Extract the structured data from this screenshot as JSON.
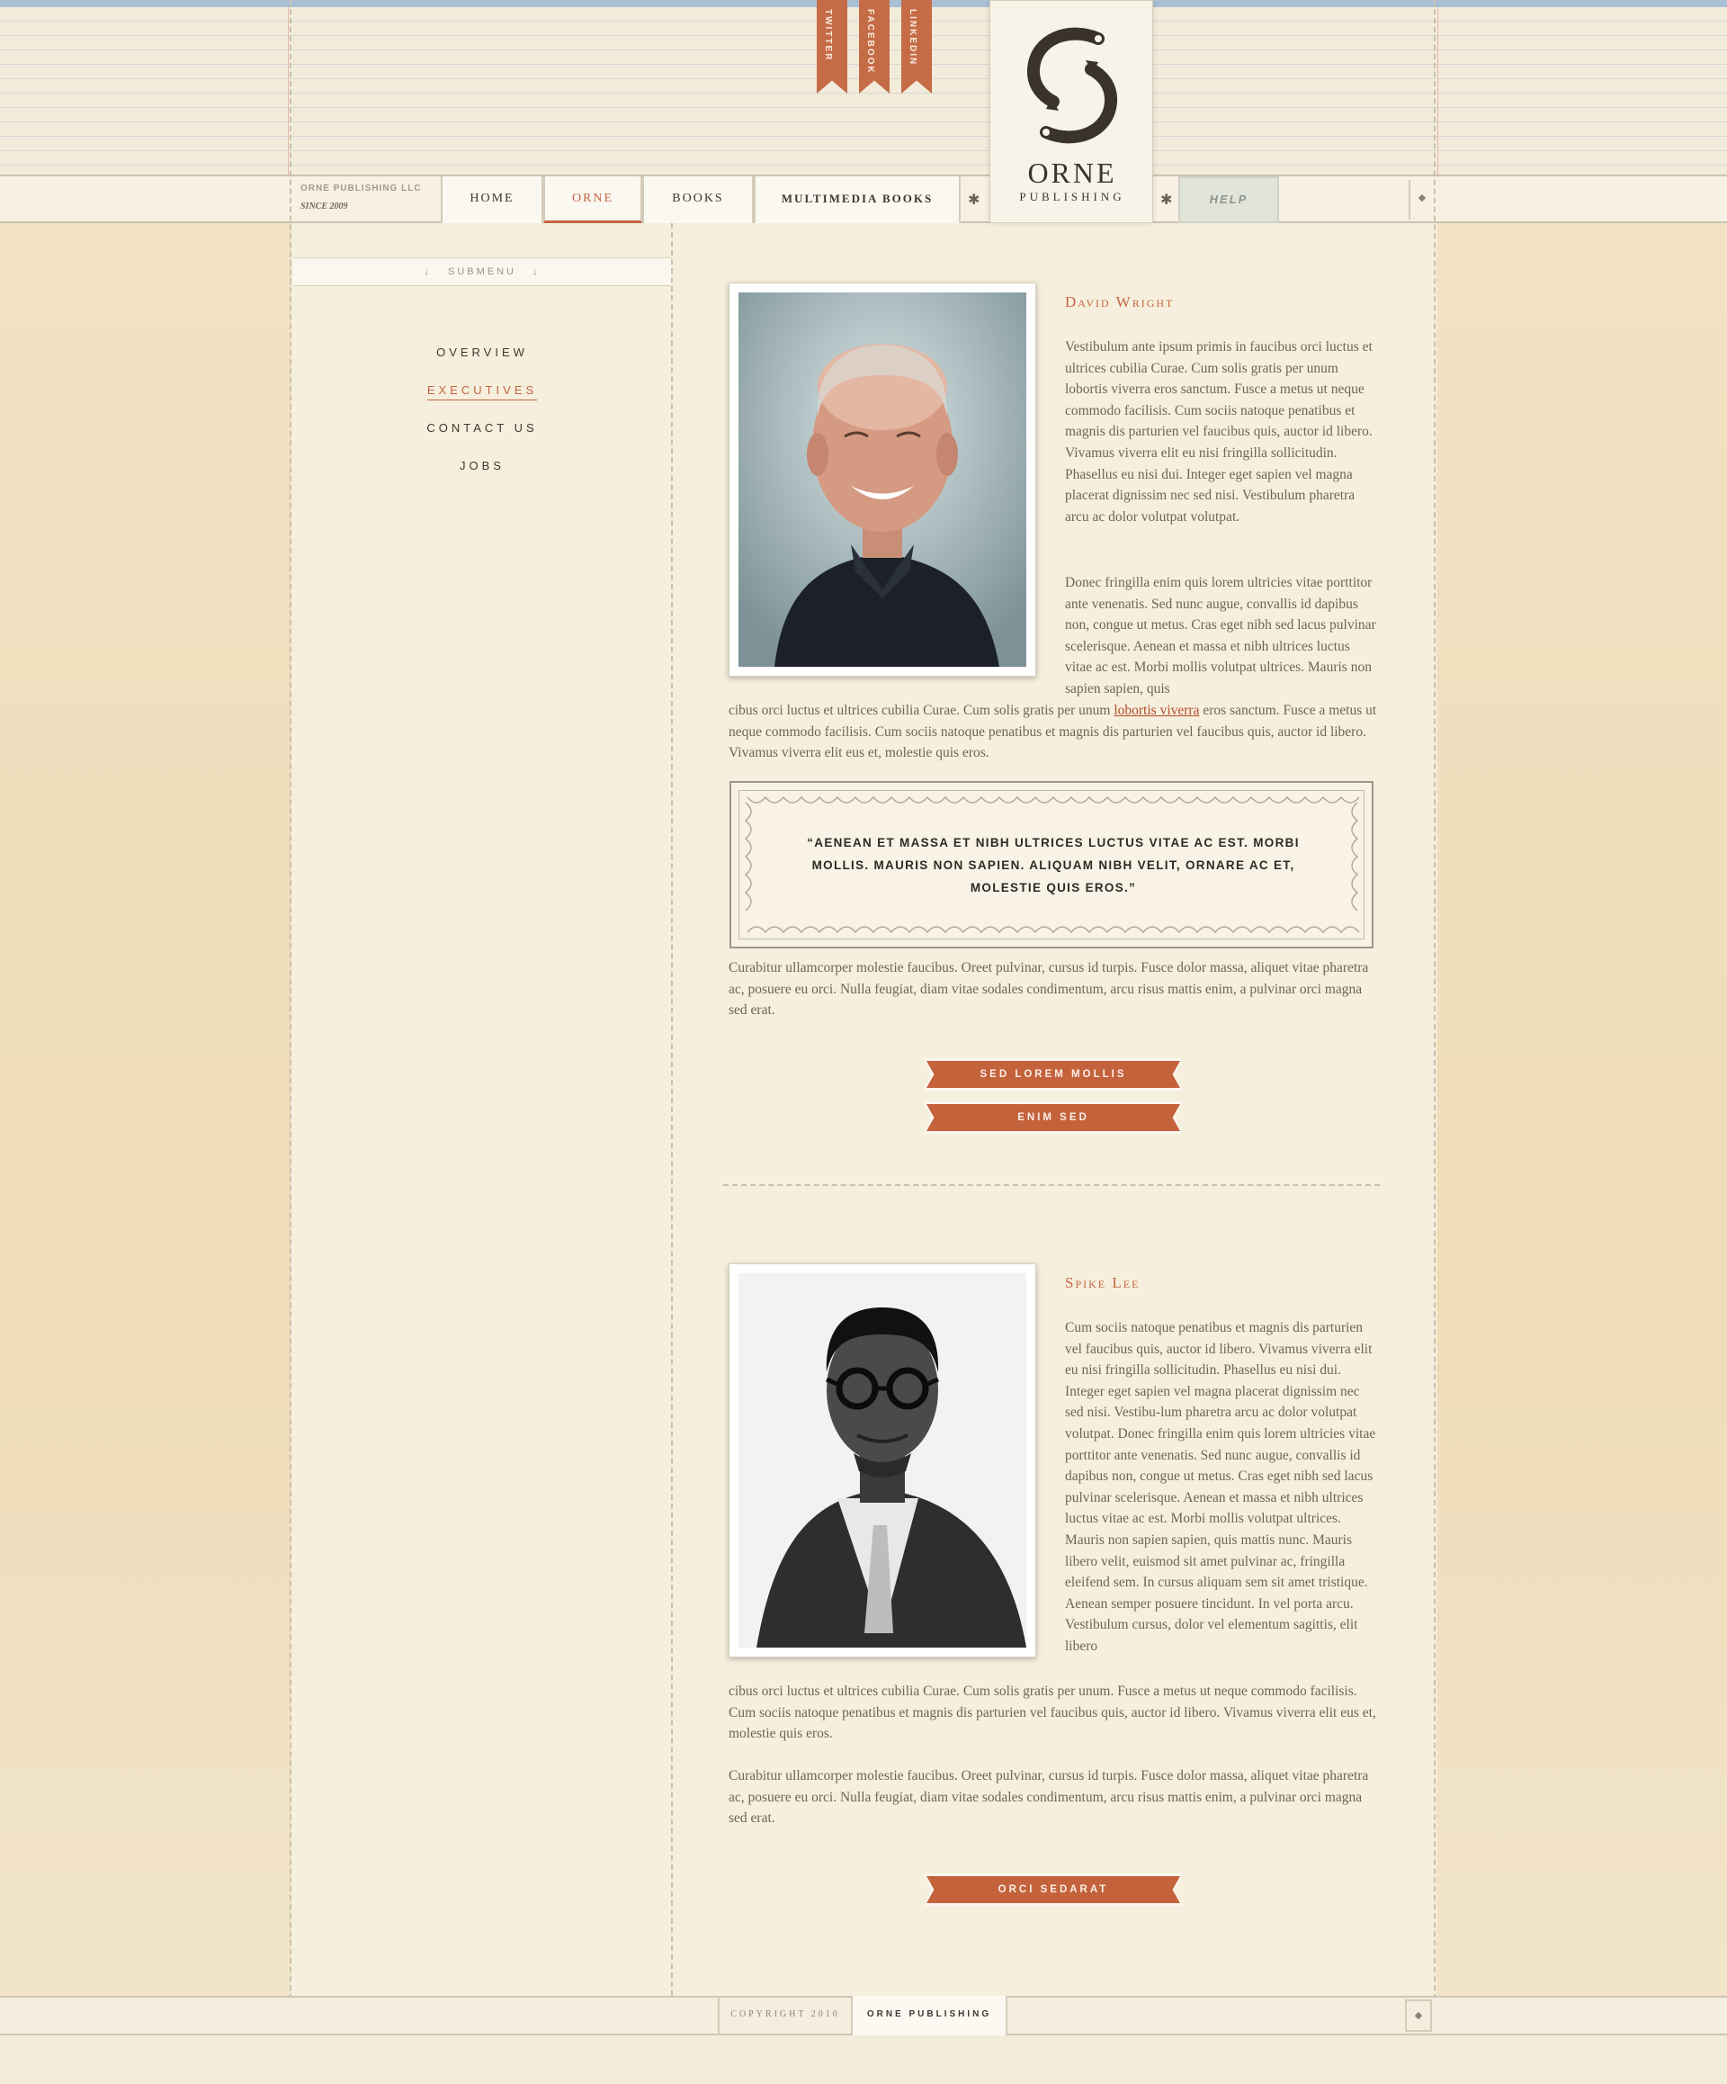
{
  "social": [
    {
      "label": "TWITTER",
      "icon": "ribbon-bookmark-icon"
    },
    {
      "label": "FACEBOOK",
      "icon": "ribbon-bookmark-icon"
    },
    {
      "label": "LINKEDIN",
      "icon": "ribbon-bookmark-icon"
    }
  ],
  "logo": {
    "name": "ORNE",
    "sub": "PUBLISHING",
    "icon": "fish-emblem-icon"
  },
  "company": {
    "name": "ORNE PUBLISHING LLC",
    "since": "SINCE 2009"
  },
  "nav": {
    "items": [
      {
        "label": "HOME"
      },
      {
        "label": "ORNE"
      },
      {
        "label": "BOOKS"
      },
      {
        "label": "MULTIMEDIA BOOKS"
      }
    ],
    "active": "ORNE",
    "help": "HELP",
    "separator": "✱"
  },
  "submenu": {
    "title": "SUBMENU",
    "icon": "arrow-down-icon",
    "items": [
      {
        "label": "OVERVIEW"
      },
      {
        "label": "EXECUTIVES"
      },
      {
        "label": "CONTACT US"
      },
      {
        "label": "JOBS"
      }
    ],
    "active": "EXECUTIVES"
  },
  "executives": [
    {
      "name": "David Wright",
      "p1": "Vestibulum ante ipsum primis in faucibus orci luctus et ultrices cubilia Curae. Cum solis gratis per unum lobortis viverra eros sanctum. Fusce a metus ut neque commodo facilisis. Cum sociis natoque penatibus et magnis dis parturien vel faucibus quis, auctor id libero. Vivamus viverra elit eu nisi fringilla sollicitudin. Phasellus eu nisi dui. Integer eget sapien vel magna placerat dignissim nec sed nisi. Vestibulum pharetra arcu ac dolor volutpat volutpat.",
      "p2_wrap": "Donec fringilla enim quis lorem ultricies vitae porttitor ante venenatis. Sed nunc augue, convallis id dapibus non, congue ut metus. Cras eget nibh sed lacus pulvinar scelerisque. Aenean et massa et nibh ultrices luctus vitae ac est. Morbi mollis volutpat ultrices. Mauris non sapien sapien, quis",
      "p2_full_a": "cibus orci luctus et ultrices cubilia Curae. Cum solis gratis per unum ",
      "p2_link": "lobortis viverra",
      "p2_full_b": " eros sanctum. Fusce a metus ut neque commodo facilisis. Cum sociis natoque penatibus et magnis dis parturien vel faucibus quis, auctor id libero. Vivamus viverra elit eus et, molestie quis eros.",
      "quote": "“Aenean et massa et nibh ultrices luctus vitae ac est. Morbi mollis. Mauris non sapien. Aliquam nibh velit, ornare ac et, molestie quis eros.”",
      "p3": "Curabitur ullamcorper molestie faucibus. Oreet pulvinar, cursus id turpis. Fusce dolor massa, aliquet vitae pharetra ac, posuere eu orci. Nulla feugiat, diam vitae sodales condimentum, arcu risus mattis enim, a pulvinar orci magna sed erat.",
      "buttons": [
        "SED LOREM MOLLIS",
        "ENIM SED"
      ]
    },
    {
      "name": "Spike Lee",
      "p1_wrap": "Cum sociis natoque penatibus et magnis dis parturien vel faucibus quis, auctor id libero. Vivamus viverra elit eu nisi fringilla sollicitudin. Phasellus eu nisi dui. Integer eget sapien vel magna placerat dignissim nec sed nisi. Vestibu-lum pharetra arcu ac dolor volutpat volutpat. Donec fringilla enim quis lorem ultricies vitae porttitor ante venenatis. Sed nunc augue, convallis id dapibus non, congue ut metus. Cras eget nibh sed lacus pulvinar scelerisque. Aenean et massa et nibh ultrices luctus vitae ac est. Morbi mollis volutpat ultrices. Mauris non sapien sapien, quis mattis nunc. Mauris libero velit, euismod sit amet pulvinar ac, fringilla eleifend sem. In cursus aliquam sem sit amet tristique. Aenean semper posuere tincidunt. In vel porta arcu. Vestibulum cursus, dolor vel elementum sagittis, elit libero",
      "p1_full": "cibus orci luctus et ultrices cubilia Curae. Cum solis gratis per unum. Fusce a metus ut neque commodo facilisis. Cum sociis natoque penatibus et magnis dis parturien vel faucibus quis, auctor id libero. Vivamus viverra elit eus et, molestie quis eros.",
      "p3": "Curabitur ullamcorper molestie faucibus. Oreet pulvinar, cursus id turpis. Fusce dolor massa, aliquet vitae pharetra ac, posuere eu orci. Nulla feugiat, diam vitae sodales condimentum, arcu risus mattis enim, a pulvinar orci magna sed erat.",
      "buttons": [
        "ORCI SEDARAT"
      ]
    }
  ],
  "footer": {
    "copyright": "COPYRIGHT 2010",
    "brand": "ORNE PUBLISHING",
    "icon": "diamond-icon"
  },
  "colors": {
    "accent": "#c46642",
    "paper": "#f6efdd",
    "ink": "#3e3830"
  }
}
